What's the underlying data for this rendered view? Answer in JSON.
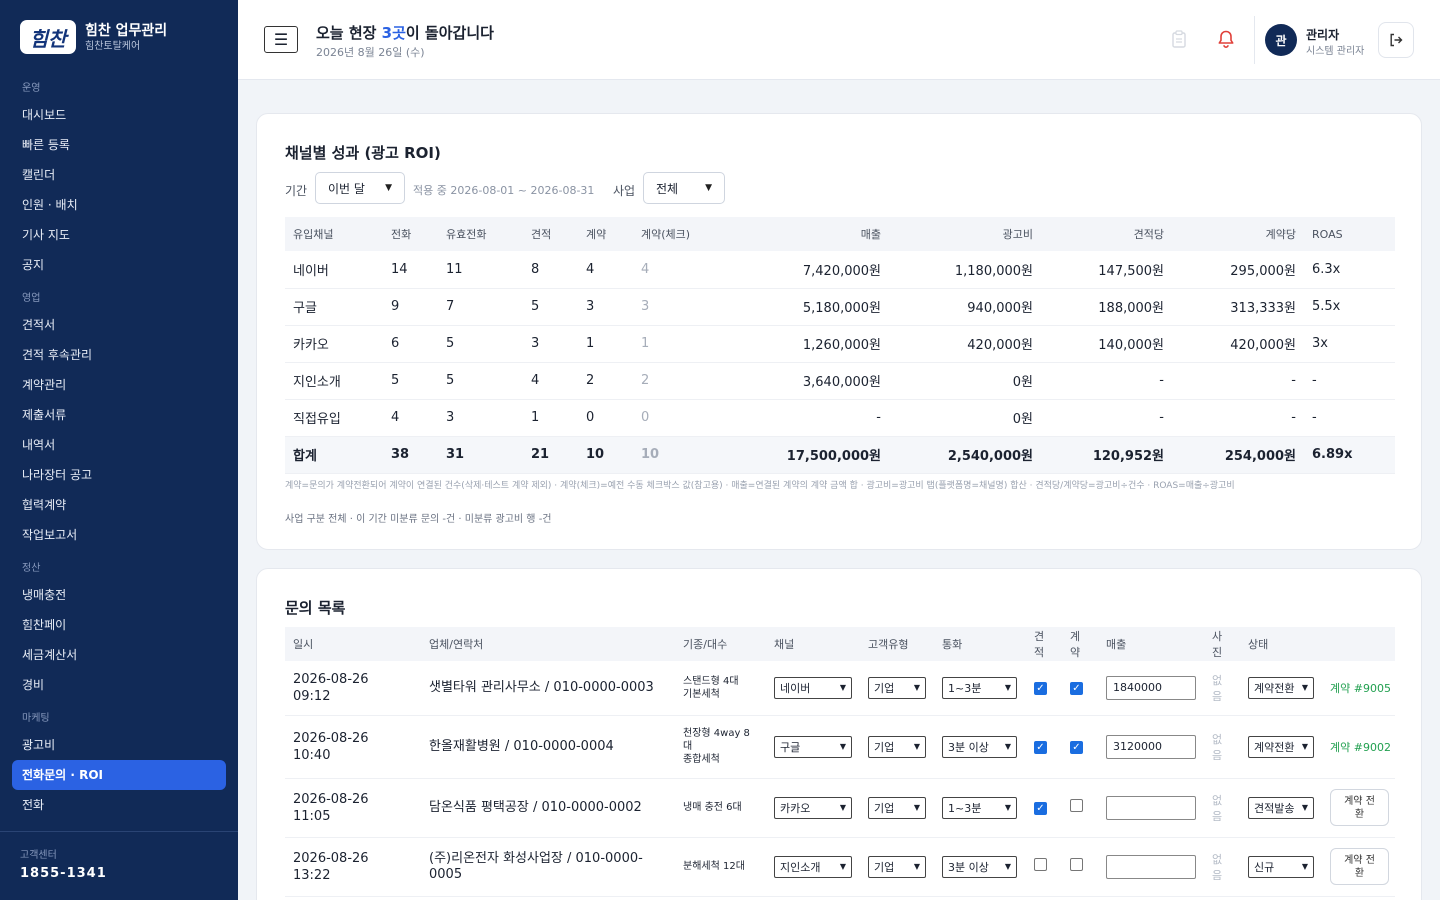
{
  "brand": {
    "logo_text": "힘찬",
    "name": "힘찬 업무관리",
    "sub": "힘찬토탈케어"
  },
  "sidebar": {
    "groups": [
      {
        "label": "운영",
        "items": [
          "대시보드",
          "빠른 등록",
          "캘린더",
          "인원 · 배치",
          "기사 지도",
          "공지"
        ]
      },
      {
        "label": "영업",
        "items": [
          "견적서",
          "견적 후속관리",
          "계약관리",
          "제출서류",
          "내역서",
          "나라장터 공고",
          "협력계약",
          "작업보고서"
        ]
      },
      {
        "label": "정산",
        "items": [
          "냉매충전",
          "힘찬페이",
          "세금계산서",
          "경비"
        ]
      },
      {
        "label": "마케팅",
        "items": [
          "광고비",
          "전화문의 · ROI",
          "전화"
        ]
      }
    ],
    "active": "전화문의 · ROI",
    "support_label": "고객센터",
    "support_phone": "1855-1341"
  },
  "topbar": {
    "menu_icon": "☰",
    "greeting_pre": "오늘 현장 ",
    "greeting_count": "3곳",
    "greeting_post": "이 돌아갑니다",
    "date": "2026년 8월 26일 (수)",
    "avatar": "관",
    "user_name": "관리자",
    "user_role": "시스템 관리자",
    "accent": "#2b62e3",
    "bell_color": "#e0403a"
  },
  "roi": {
    "title": "채널별 성과 (광고 ROI)",
    "period_label": "기간",
    "period_value": "이번 달",
    "period_note": "적용 중 2026-08-01 ~ 2026-08-31",
    "biz_label": "사업",
    "biz_value": "전체",
    "headers": [
      "유입채널",
      "전화",
      "유효전화",
      "견적",
      "계약",
      "계약(체크)",
      "매출",
      "광고비",
      "견적당",
      "계약당",
      "ROAS"
    ],
    "rows": [
      [
        "네이버",
        "14",
        "11",
        "8",
        "4",
        "4",
        "7,420,000원",
        "1,180,000원",
        "147,500원",
        "295,000원",
        "6.3x"
      ],
      [
        "구글",
        "9",
        "7",
        "5",
        "3",
        "3",
        "5,180,000원",
        "940,000원",
        "188,000원",
        "313,333원",
        "5.5x"
      ],
      [
        "카카오",
        "6",
        "5",
        "3",
        "1",
        "1",
        "1,260,000원",
        "420,000원",
        "140,000원",
        "420,000원",
        "3x"
      ],
      [
        "지인소개",
        "5",
        "5",
        "4",
        "2",
        "2",
        "3,640,000원",
        "0원",
        "-",
        "-",
        "-"
      ],
      [
        "직접유입",
        "4",
        "3",
        "1",
        "0",
        "0",
        "-",
        "0원",
        "-",
        "-",
        "-"
      ]
    ],
    "total": [
      "합계",
      "38",
      "31",
      "21",
      "10",
      "10",
      "17,500,000원",
      "2,540,000원",
      "120,952원",
      "254,000원",
      "6.89x"
    ],
    "legend": "계약=문의가 계약전환되어 계약이 연결된 건수(삭제·테스트 계약 제외) · 계약(체크)=예전 수동 체크박스 값(참고용) · 매출=연결된 계약의 계약 금액 합 · 광고비=광고비 탭(플랫폼명=채널명) 합산 · 견적당/계약당=광고비÷건수 · ROAS=매출÷광고비",
    "biz_note": "사업 구분 전체 · 이 기간 미분류 문의 -건 · 미분류 광고비 행 -건"
  },
  "inquiries": {
    "title": "문의 목록",
    "headers": [
      "일시",
      "업체/연락처",
      "기종/대수",
      "채널",
      "고객유형",
      "통화",
      "견적",
      "계약",
      "매출",
      "사진",
      "상태",
      ""
    ],
    "rows": [
      {
        "date": "2026-08-26",
        "time": "09:12",
        "company": "샛별타워 관리사무소 / 010-0000-0003",
        "model": "스탠드형 4대\n기본세척",
        "channel": "네이버",
        "type": "기업",
        "call": "1~3분",
        "quote": true,
        "contract": true,
        "sales": "1840000",
        "photo": "없음",
        "status": "계약전환",
        "action": "계약 #9005"
      },
      {
        "date": "2026-08-26",
        "time": "10:40",
        "company": "한올재활병원 / 010-0000-0004",
        "model": "천장형 4way 8\n대\n종합세척",
        "channel": "구글",
        "type": "기업",
        "call": "3분 이상",
        "quote": true,
        "contract": true,
        "sales": "3120000",
        "photo": "없음",
        "status": "계약전환",
        "action": "계약 #9002"
      },
      {
        "date": "2026-08-26",
        "time": "11:05",
        "company": "담온식품 평택공장 / 010-0000-0002",
        "model": "냉매 충전 6대",
        "channel": "카카오",
        "type": "기업",
        "call": "1~3분",
        "quote": true,
        "contract": false,
        "sales": "",
        "photo": "없음",
        "status": "견적발송",
        "action": "계약 전\n환"
      },
      {
        "date": "2026-08-26",
        "time": "13:22",
        "company": "(주)리온전자 화성사업장 / 010-0000-\n0005",
        "model": "분해세척 12대",
        "channel": "지인소개",
        "type": "기업",
        "call": "3분 이상",
        "quote": false,
        "contract": false,
        "sales": "",
        "photo": "없음",
        "status": "신규",
        "action": "계약 전\n환"
      }
    ]
  }
}
